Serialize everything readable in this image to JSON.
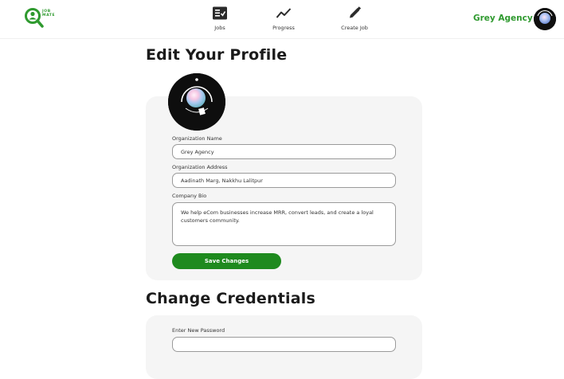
{
  "header": {
    "logo_text_line1": "JOB",
    "logo_text_line2": "MATE",
    "nav": [
      {
        "label": "Jobs",
        "icon": "list-check-icon"
      },
      {
        "label": "Progress",
        "icon": "trend-line-icon"
      },
      {
        "label": "Create Job",
        "icon": "pencil-icon"
      }
    ],
    "org_name": "Grey Agency",
    "accent_color": "#2f9a2f"
  },
  "profile": {
    "title": "Edit Your Profile",
    "org_name_label": "Organization Name",
    "org_name_value": "Grey Agency",
    "org_address_label": "Organization Address",
    "org_address_value": "Aadinath Marg, Nakkhu Lalitpur",
    "bio_label": "Company Bio",
    "bio_value": "We help eCom businesses increase MRR, convert leads, and create a loyal customers community.",
    "save_label": "Save Changes",
    "save_color": "#1e8a1e"
  },
  "credentials": {
    "title": "Change Credentials",
    "new_password_label": "Enter New Password",
    "new_password_value": ""
  }
}
